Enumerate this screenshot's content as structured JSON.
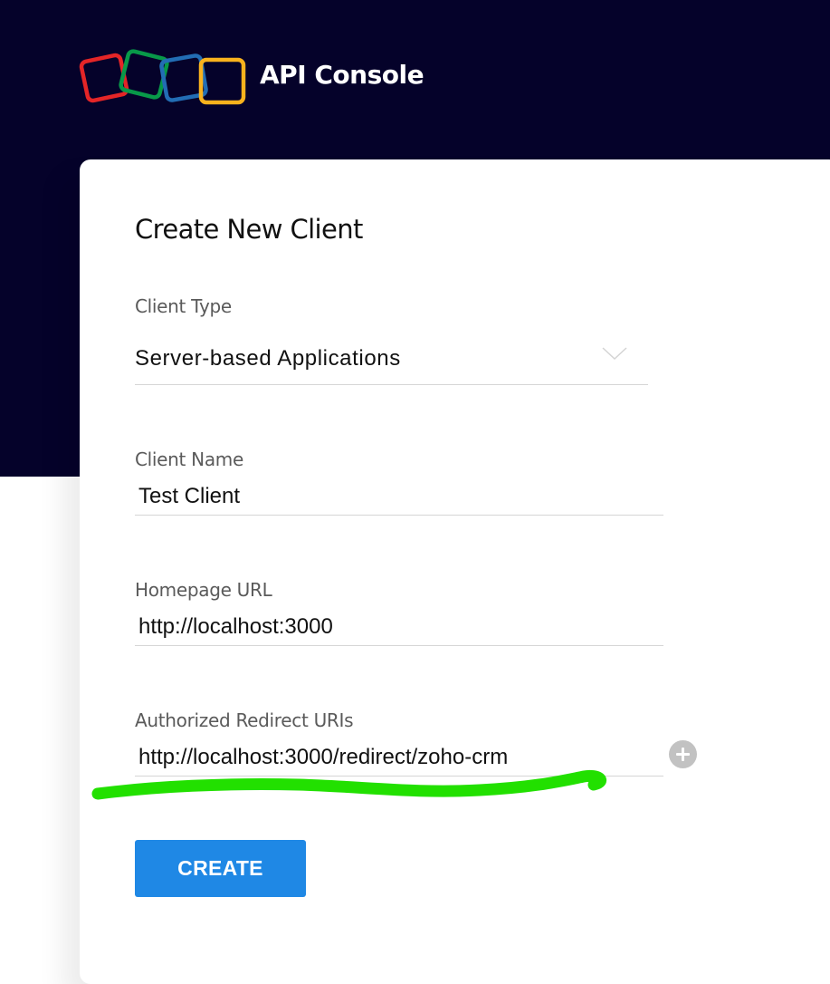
{
  "header": {
    "brand": "API Console",
    "logo_colors": [
      "#e42527",
      "#089949",
      "#226db4",
      "#f9b21d"
    ]
  },
  "form": {
    "title": "Create New Client",
    "client_type": {
      "label": "Client Type",
      "value": "Server-based Applications"
    },
    "client_name": {
      "label": "Client Name",
      "value": "Test Client"
    },
    "homepage_url": {
      "label": "Homepage URL",
      "value": "http://localhost:3000"
    },
    "redirect_uris": {
      "label": "Authorized Redirect URIs",
      "value": "http://localhost:3000/redirect/zoho-crm"
    },
    "create_label": "CREATE"
  },
  "colors": {
    "header_bg": "#05022a",
    "primary_button": "#1f88e5",
    "annotation": "#22e000"
  }
}
